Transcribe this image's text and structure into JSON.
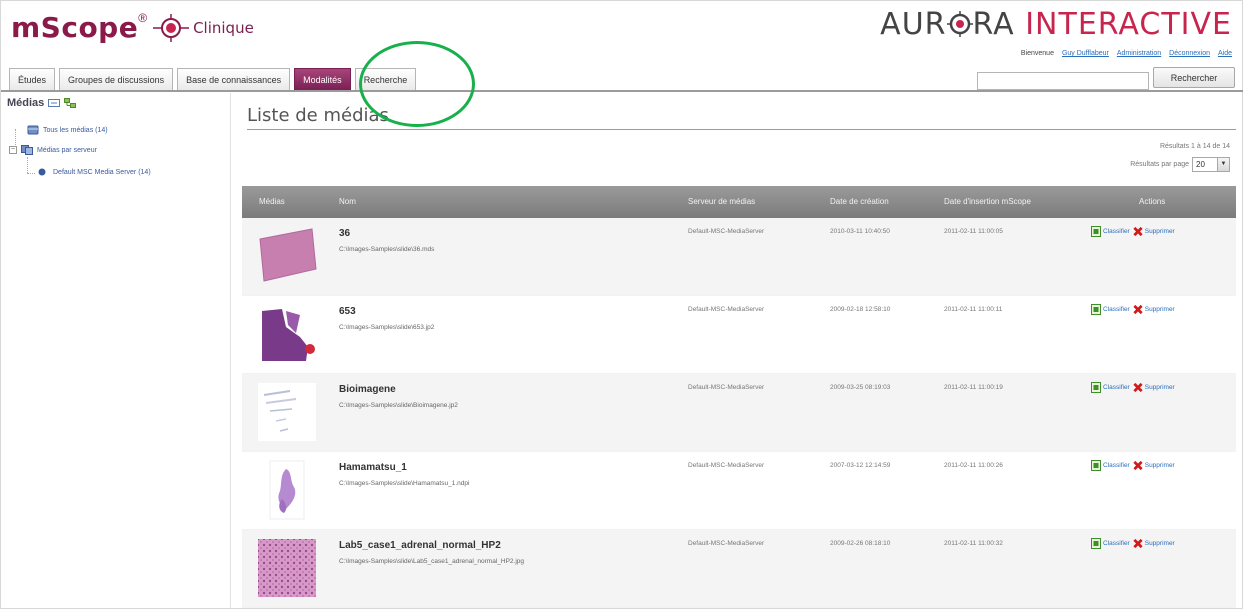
{
  "header": {
    "brand": "mScope",
    "brand_reg": "®",
    "brand_sub": "Clinique",
    "company_part1": "AUR",
    "company_part2": "RA",
    "company_part3": "INTERACTIVE",
    "welcome": "Bienvenue",
    "user_link": "Guy Dufflabeur",
    "admin_link": "Administration",
    "logout_link": "Déconnexion",
    "help_link": "Aide"
  },
  "tabs": [
    {
      "label": "Études",
      "active": false
    },
    {
      "label": "Groupes de discussions",
      "active": false
    },
    {
      "label": "Base de connaissances",
      "active": false
    },
    {
      "label": "Modalités",
      "active": true
    },
    {
      "label": "Recherche",
      "active": false
    }
  ],
  "search": {
    "value": "",
    "button_label": "Rechercher"
  },
  "sidebar": {
    "title": "Médias",
    "items": [
      {
        "label": "Tous les médias (14)"
      },
      {
        "label": "Médias par serveur"
      },
      {
        "label": "Default MSC Media Server (14)"
      }
    ]
  },
  "main": {
    "title": "Liste de médias",
    "results_info": "Résultats 1 à 14 de 14",
    "per_page_label": "Résultats par page",
    "per_page_value": "20",
    "columns": {
      "media": "Médias",
      "name": "Nom",
      "server": "Serveur de médias",
      "created": "Date de création",
      "inserted": "Date d'insertion mScope",
      "actions": "Actions"
    },
    "classify_label": "Classifier",
    "delete_label": "Supprimer",
    "rows": [
      {
        "name": "36",
        "path": "C:\\Images-Samples\\slide\\36.mds",
        "server": "Default-MSC-MediaServer",
        "created": "2010-03-11 10:40:50",
        "inserted": "2011-02-11 11:00:05",
        "thumb": "pink-slide"
      },
      {
        "name": "653",
        "path": "C:\\Images-Samples\\slide\\653.jp2",
        "server": "Default-MSC-MediaServer",
        "created": "2009-02-18 12:58:10",
        "inserted": "2011-02-11 11:00:11",
        "thumb": "purple-tissue"
      },
      {
        "name": "Bioimagene",
        "path": "C:\\Images-Samples\\slide\\Bioimagene.jp2",
        "server": "Default-MSC-MediaServer",
        "created": "2009-03-25 08:19:03",
        "inserted": "2011-02-11 11:00:19",
        "thumb": "faint-strips"
      },
      {
        "name": "Hamamatsu_1",
        "path": "C:\\Images-Samples\\slide\\Hamamatsu_1.ndpi",
        "server": "Default-MSC-MediaServer",
        "created": "2007-03-12 12:14:59",
        "inserted": "2011-02-11 11:00:26",
        "thumb": "violet-blob"
      },
      {
        "name": "Lab5_case1_adrenal_normal_HP2",
        "path": "C:\\Images-Samples\\slide\\Lab5_case1_adrenal_normal_HP2.jpg",
        "server": "Default-MSC-MediaServer",
        "created": "2009-02-26 08:18:10",
        "inserted": "2011-02-11 11:00:32",
        "thumb": "pink-texture"
      }
    ]
  },
  "colors": {
    "brand": "#8a1a4a",
    "active_tab": "#7a1f55",
    "annotation": "#18b04b",
    "link": "#2a6ebd"
  }
}
